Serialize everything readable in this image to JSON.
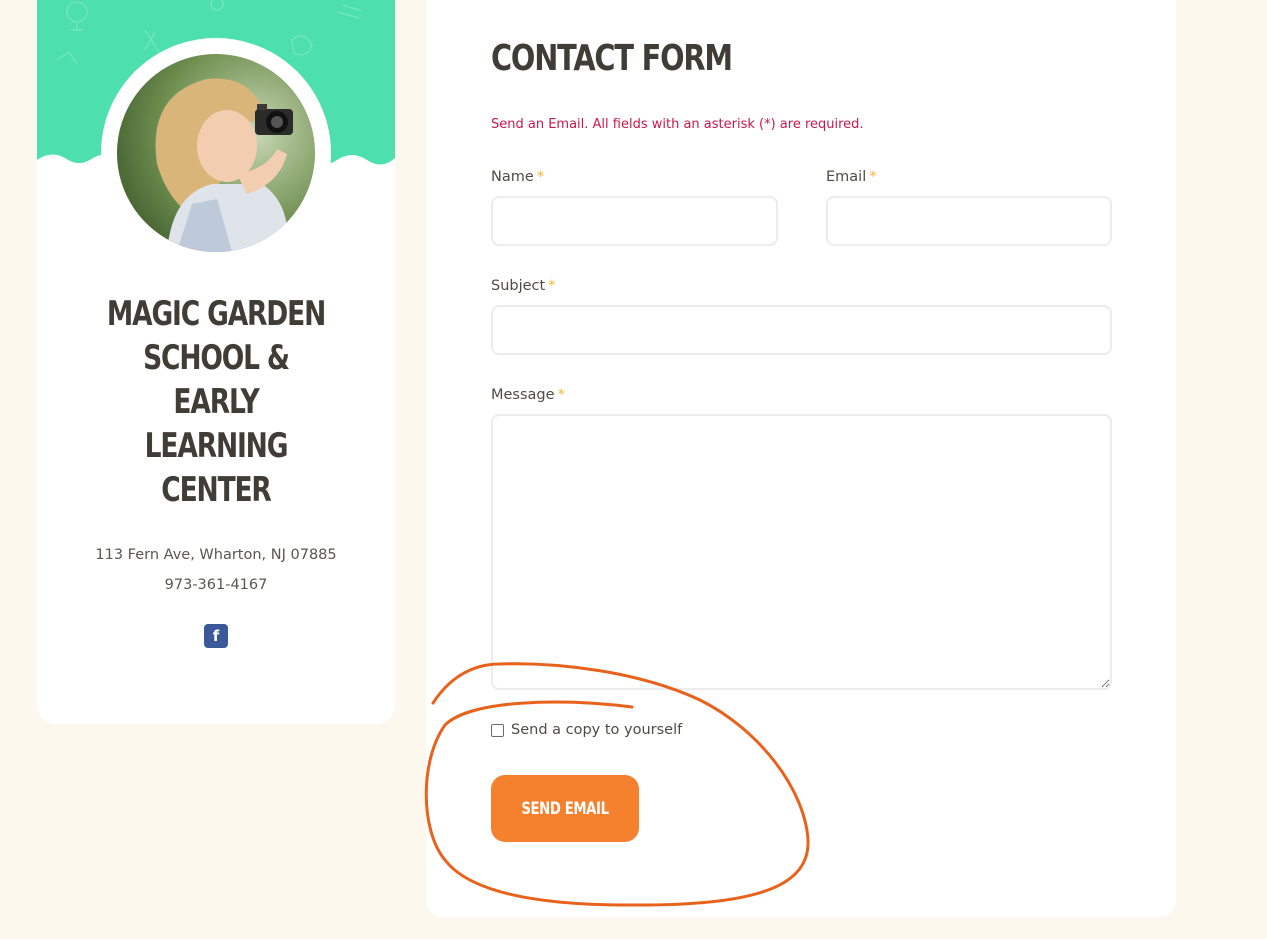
{
  "profile": {
    "school_name": "MAGIC GARDEN SCHOOL & EARLY LEARNING CENTER",
    "address": "113 Fern Ave, Wharton, NJ 07885",
    "phone": "973-361-4167",
    "social_icon": "facebook-icon",
    "social_glyph": "f",
    "photo": "girl-with-camera"
  },
  "form": {
    "title": "CONTACT FORM",
    "note": "Send an Email. All fields with an asterisk (*) are required.",
    "required_mark": "*",
    "fields": {
      "name": {
        "label": "Name",
        "value": ""
      },
      "email": {
        "label": "Email",
        "value": ""
      },
      "subject": {
        "label": "Subject",
        "value": ""
      },
      "message": {
        "label": "Message",
        "value": ""
      }
    },
    "copy_label": "Send a copy to yourself",
    "copy_checked": false,
    "submit_label": "SEND EMAIL"
  },
  "colors": {
    "page_background": "#fdf8ee",
    "header_green": "#4ddfad",
    "accent_orange": "#f5812f",
    "annotation_orange": "#e8621b",
    "note_red": "#c8194a",
    "asterisk_yellow": "#f2b632",
    "facebook_blue": "#3b5998"
  }
}
